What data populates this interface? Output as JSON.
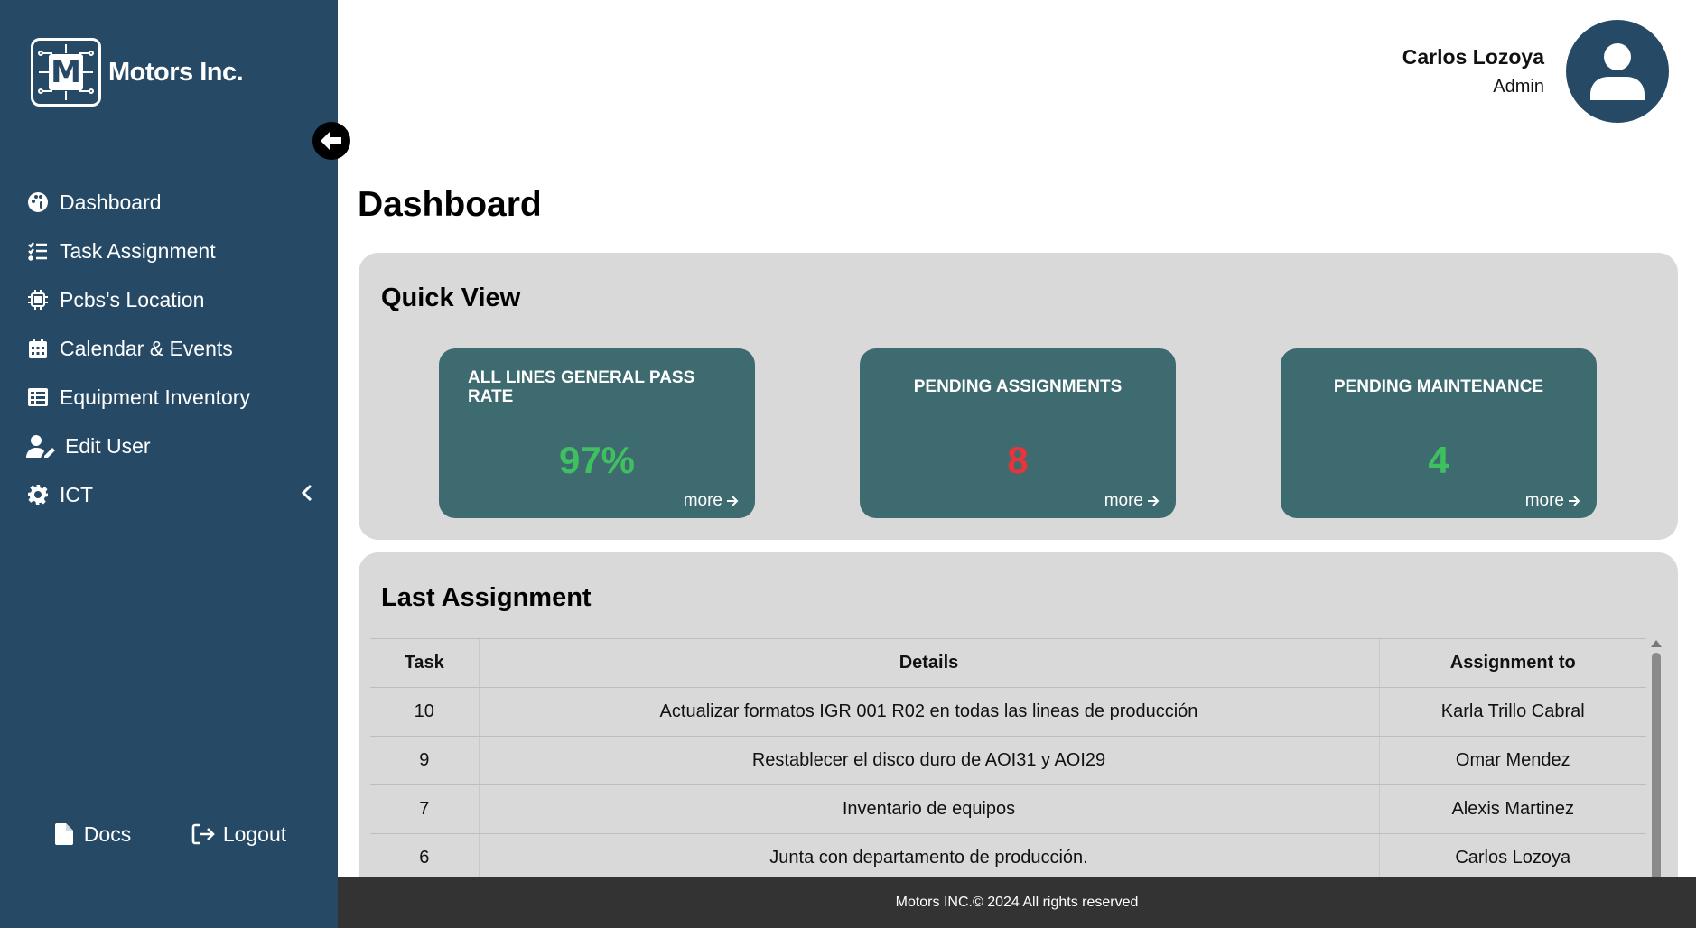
{
  "brand": {
    "name": "Motors Inc.",
    "logo_letter": "M"
  },
  "sidebar": {
    "items": [
      {
        "label": "Dashboard",
        "icon": "palette-icon"
      },
      {
        "label": "Task Assignment",
        "icon": "list-check-icon"
      },
      {
        "label": "Pcbs's Location",
        "icon": "chip-icon"
      },
      {
        "label": "Calendar & Events",
        "icon": "calendar-icon"
      },
      {
        "label": "Equipment Inventory",
        "icon": "table-list-icon"
      },
      {
        "label": "Edit User",
        "icon": "user-pen-icon"
      },
      {
        "label": "ICT",
        "icon": "gear-icon"
      }
    ],
    "docs_label": "Docs",
    "logout_label": "Logout"
  },
  "user": {
    "name": "Carlos Lozoya",
    "role": "Admin"
  },
  "page_title": "Dashboard",
  "quick_view": {
    "title": "Quick View",
    "cards": [
      {
        "title": "ALL LINES GENERAL PASS RATE",
        "value": "97%",
        "value_color": "#3fbf5f",
        "more": "more"
      },
      {
        "title": "PENDING ASSIGNMENTS",
        "value": "8",
        "value_color": "#e8353b",
        "more": "more"
      },
      {
        "title": "PENDING MAINTENANCE",
        "value": "4",
        "value_color": "#3fbf5f",
        "more": "more"
      }
    ]
  },
  "last_assignment": {
    "title": "Last Assignment",
    "columns": [
      "Task",
      "Details",
      "Assignment to"
    ],
    "rows": [
      [
        "10",
        "Actualizar formatos IGR 001 R02 en todas las lineas de producción",
        "Karla Trillo Cabral"
      ],
      [
        "9",
        "Restablecer el disco duro de AOI31 y AOI29",
        "Omar Mendez"
      ],
      [
        "7",
        "Inventario de equipos",
        "Alexis Martinez"
      ],
      [
        "6",
        "Junta con departamento de producción.",
        "Carlos Lozoya"
      ]
    ]
  },
  "footer": "Motors INC.© 2024 All rights reserved",
  "colors": {
    "sidebar": "#264a66",
    "card": "#3d6b70",
    "panel": "#d9d9d9",
    "footer": "#333333"
  }
}
